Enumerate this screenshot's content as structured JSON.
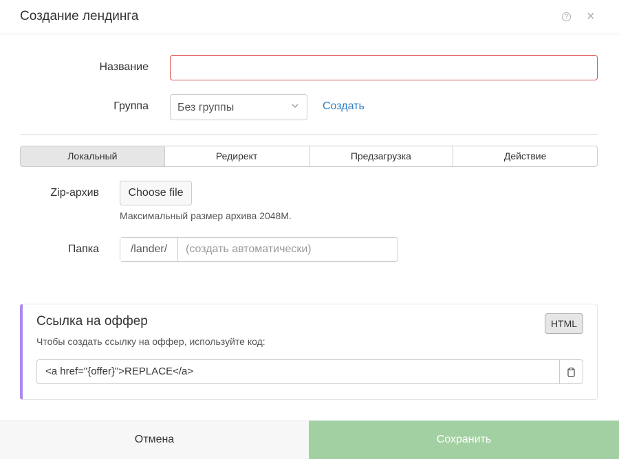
{
  "header": {
    "title": "Создание лендинга",
    "help_icon": "question-circle-icon",
    "help_glyph": "?",
    "close_icon": "close-icon",
    "close_glyph": "×"
  },
  "form": {
    "name_label": "Название",
    "name_value": "",
    "group_label": "Группа",
    "group_value": "Без группы",
    "create_link": "Создать"
  },
  "tabs": [
    {
      "label": "Локальный",
      "active": true
    },
    {
      "label": "Редирект",
      "active": false
    },
    {
      "label": "Предзагрузка",
      "active": false
    },
    {
      "label": "Действие",
      "active": false
    }
  ],
  "local": {
    "zip_label": "Zip-архив",
    "choose_file": "Choose file",
    "max_size_hint": "Максимальный размер архива 2048M.",
    "folder_label": "Папка",
    "folder_prefix": "/lander/",
    "folder_placeholder": "(создать автоматически)"
  },
  "offer": {
    "title": "Ссылка на оффер",
    "subtitle": "Чтобы создать ссылку на оффер, используйте код:",
    "html_button": "HTML",
    "code": "<a href=\"{offer}\">REPLACE</a>",
    "copy_icon": "clipboard-icon"
  },
  "footer": {
    "cancel": "Отмена",
    "save": "Сохранить"
  },
  "colors": {
    "accent_link": "#2a7ec4",
    "error_border": "#d9534f",
    "panel_accent": "#a98bf0",
    "save_disabled": "#a3d0a3"
  }
}
